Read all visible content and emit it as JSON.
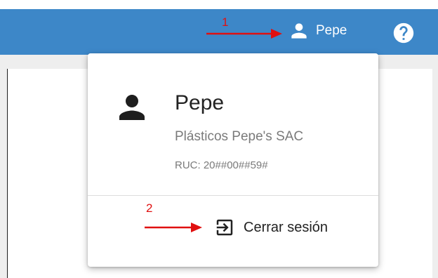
{
  "header": {
    "user_name": "Pepe",
    "user_icon": "person-icon",
    "help_icon": "help-circle-icon",
    "bar_color": "#3d87c8"
  },
  "profile_popover": {
    "name": "Pepe",
    "company": "Plásticos Pepe's SAC",
    "ruc": "RUC: 20##00##59#",
    "avatar_icon": "person-icon",
    "logout": {
      "label": "Cerrar sesión",
      "icon": "logout-icon"
    }
  },
  "annotations": [
    {
      "number": "1",
      "color": "#e01010"
    },
    {
      "number": "2",
      "color": "#e01010"
    }
  ]
}
